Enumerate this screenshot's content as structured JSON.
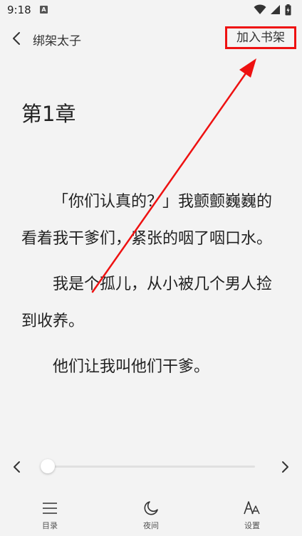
{
  "status_bar": {
    "time": "9:18",
    "app_icon_letter": "A"
  },
  "header": {
    "book_title": "绑架太子",
    "add_to_shelf": "加入书架"
  },
  "chapter": {
    "title": "第1章",
    "paragraphs": [
      "「你们认真的？」我颤颤巍巍的看着我干爹们，紧张的咽了咽口水。",
      "我是个孤儿，从小被几个男人捡到收养。",
      "他们让我叫他们干爹。"
    ]
  },
  "reader_progress": {
    "value": 0
  },
  "bottom_nav": {
    "toc_label": "目录",
    "night_label": "夜间",
    "settings_label": "设置"
  },
  "colors": {
    "background": "#f3f3f3",
    "annotation_red": "#ee1111"
  }
}
